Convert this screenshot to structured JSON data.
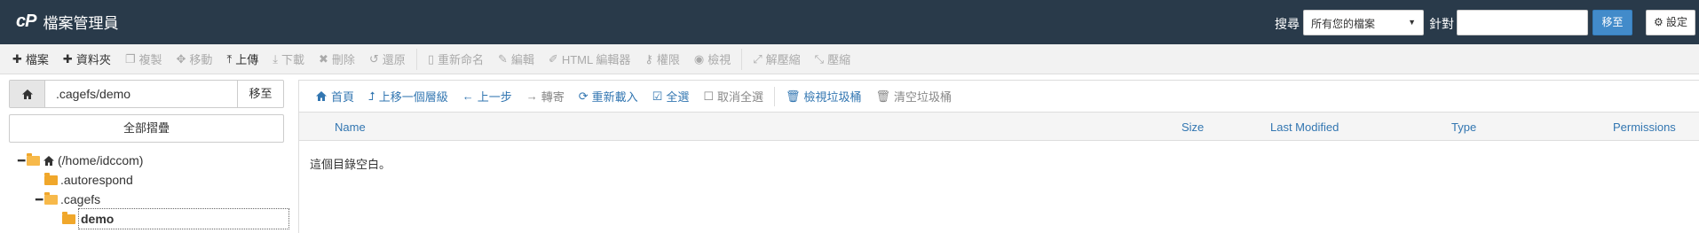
{
  "header": {
    "logo": "cP",
    "title": "檔案管理員",
    "search_label": "搜尋",
    "search_scope": "所有您的檔案",
    "for_label": "針對",
    "search_value": "",
    "go_label": "移至",
    "settings_label": "設定"
  },
  "toolbar": {
    "file": "檔案",
    "folder": "資料夾",
    "copy": "複製",
    "move": "移動",
    "upload": "上傳",
    "download": "下載",
    "delete": "刪除",
    "restore": "還原",
    "rename": "重新命名",
    "edit": "編輯",
    "html_editor": "HTML 編輯器",
    "permissions": "權限",
    "view": "檢視",
    "extract": "解壓縮",
    "compress": "壓縮"
  },
  "sidebar": {
    "path": ".cagefs/demo",
    "go_label": "移至",
    "collapse_all": "全部摺疊",
    "tree": {
      "root": "(/home/idccom)",
      "autorespond": ".autorespond",
      "cagefs": ".cagefs",
      "demo": "demo"
    }
  },
  "nav": {
    "home": "首頁",
    "up_level": "上移一個層級",
    "back": "上一步",
    "forward": "轉寄",
    "reload": "重新載入",
    "select_all": "全選",
    "unselect_all": "取消全選",
    "view_trash": "檢視垃圾桶",
    "empty_trash": "清空垃圾桶"
  },
  "table": {
    "columns": [
      "Name",
      "Size",
      "Last Modified",
      "Type",
      "Permissions"
    ],
    "empty_message": "這個目錄空白。"
  }
}
